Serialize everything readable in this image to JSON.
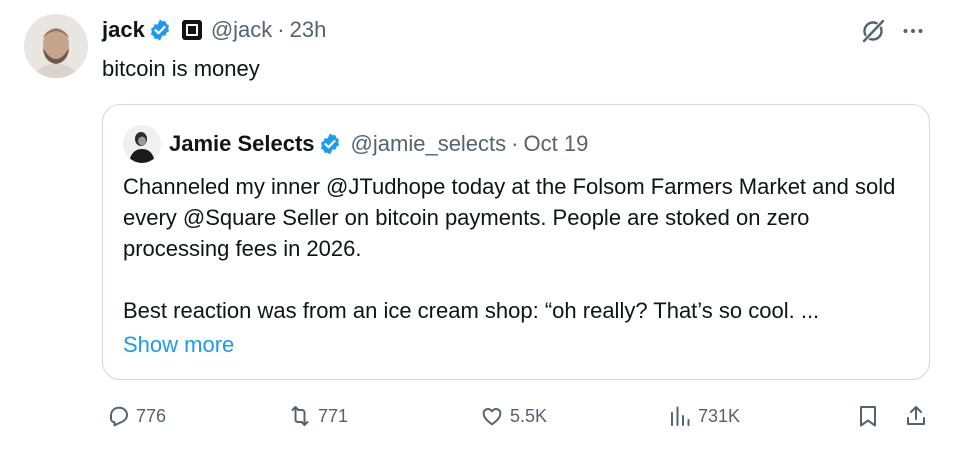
{
  "tweet": {
    "author": {
      "name": "jack",
      "handle": "@jack",
      "verified": true,
      "avatar_icon": "profile-photo"
    },
    "time": "23h",
    "separator": "·",
    "text": "bitcoin is money",
    "icons": {
      "grok": "grok-icon",
      "more": "more-icon"
    }
  },
  "quote": {
    "author": {
      "name": "Jamie Selects",
      "handle": "@jamie_selects",
      "verified": true,
      "avatar_icon": "profile-photo"
    },
    "separator": "·",
    "date": "Oct 19",
    "paragraphs": [
      "Channeled my inner @JTudhope today at the Folsom Farmers Market and sold every @Square Seller on bitcoin payments. People are stoked on zero processing fees in 2026.",
      "Best reaction was from an ice cream shop: “oh really? That’s so cool. ..."
    ],
    "show_more": "Show more"
  },
  "actions": {
    "replies": "776",
    "reposts": "771",
    "likes": "5.5K",
    "views": "731K"
  },
  "colors": {
    "text": "#0f1419",
    "secondary": "#536471",
    "link": "#1d9bf0",
    "verified": "#1d9bf0",
    "border": "#cfd9de"
  }
}
